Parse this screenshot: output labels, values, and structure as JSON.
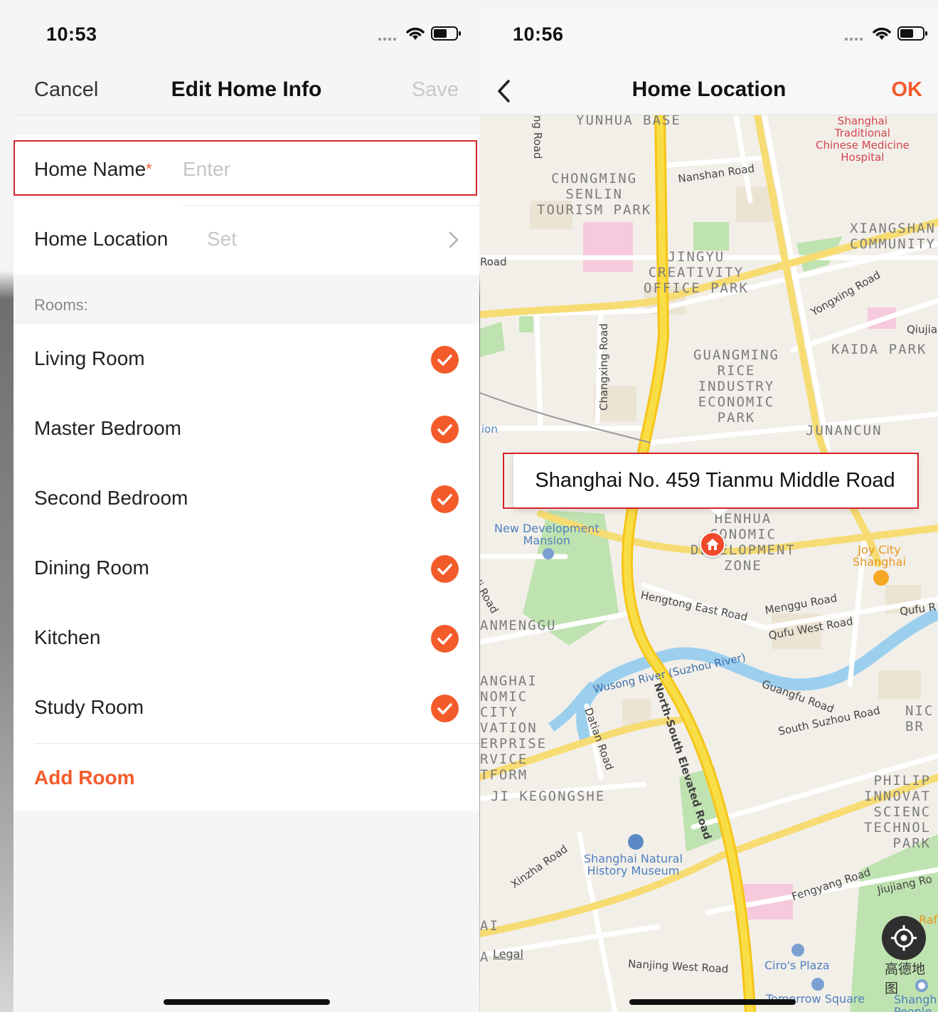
{
  "left": {
    "status_time": "10:53",
    "nav": {
      "cancel": "Cancel",
      "title": "Edit Home Info",
      "save": "Save"
    },
    "home_name": {
      "label": "Home Name",
      "required_mark": "*",
      "placeholder": "Enter"
    },
    "home_location": {
      "label": "Home Location",
      "value": "Set"
    },
    "rooms_title": "Rooms:",
    "rooms": [
      {
        "label": "Living Room",
        "checked": true
      },
      {
        "label": "Master Bedroom",
        "checked": true
      },
      {
        "label": "Second Bedroom",
        "checked": true
      },
      {
        "label": "Dining Room",
        "checked": true
      },
      {
        "label": "Kitchen",
        "checked": true
      },
      {
        "label": "Study Room",
        "checked": true
      }
    ],
    "add_room": "Add Room"
  },
  "right": {
    "status_time": "10:56",
    "nav": {
      "title": "Home Location",
      "ok": "OK"
    },
    "callout": "Shanghai No. 459 Tianmu Middle Road",
    "map": {
      "areas": [
        "YUNHUA BASE",
        "CHONGMING\nSENLIN\nTOURISM PARK",
        "JINGYU\nCREATIVITY\nOFFICE PARK",
        "XIANGSHAN\nCOMMUNITY",
        "GUANGMING\nRICE\nINDUSTRY\nECONOMIC\nPARK",
        "KAIDA PARK",
        "JUNANCUN",
        "HENHUA\nCONOMIC\nDEVELOPMENT\nZONE",
        "ANMENGGU",
        "ANGHAI\nNOMIC\nCITY\nVATION\nERPRISE\nRVICE\nTFORM",
        "JI KEGONGSHE",
        "NIC\nBR",
        "PHILIP\nINNOVAT\nSCIENC\nTECHNOL\nPARK"
      ],
      "roads": [
        "ng Road",
        "Nanshan Road",
        "Road",
        "Changxing Road",
        "Yongxing Road",
        "Qiujia",
        "ion",
        "Hengtong East Road",
        "Menggu Road",
        "Qufu West Road",
        "Qufu R",
        "Wusong River (Suzhou River)",
        "North-South Elevated Road",
        "Datian Road",
        "Guangfu Road",
        "South Suzhou Road",
        "Xinzha Road",
        "Fengyang Road",
        "Jiujiang Ro",
        "Nanjing West Road",
        "li Road"
      ],
      "pois": {
        "hospital": "Shanghai\nTraditional\nChinese Medicine\nHospital",
        "mansion": "New Development\nMansion",
        "joy_city": "Joy City\nShanghai",
        "museum": "Shanghai Natural\nHistory Museum",
        "ciros": "Ciro's Plaza",
        "tomorrow": "Tomorrow Square",
        "raf": "Raf",
        "shanghai_peoples": "Shangh\nPeople"
      },
      "legal": "Legal",
      "edge_labels": [
        "AI",
        "A"
      ],
      "logo": "高德地图"
    }
  },
  "colors": {
    "accent": "#f35b2a",
    "highlight": "#d6242b",
    "road_major": "#f7d54a",
    "river": "#a6d6f2",
    "park": "#c4e6b0"
  }
}
